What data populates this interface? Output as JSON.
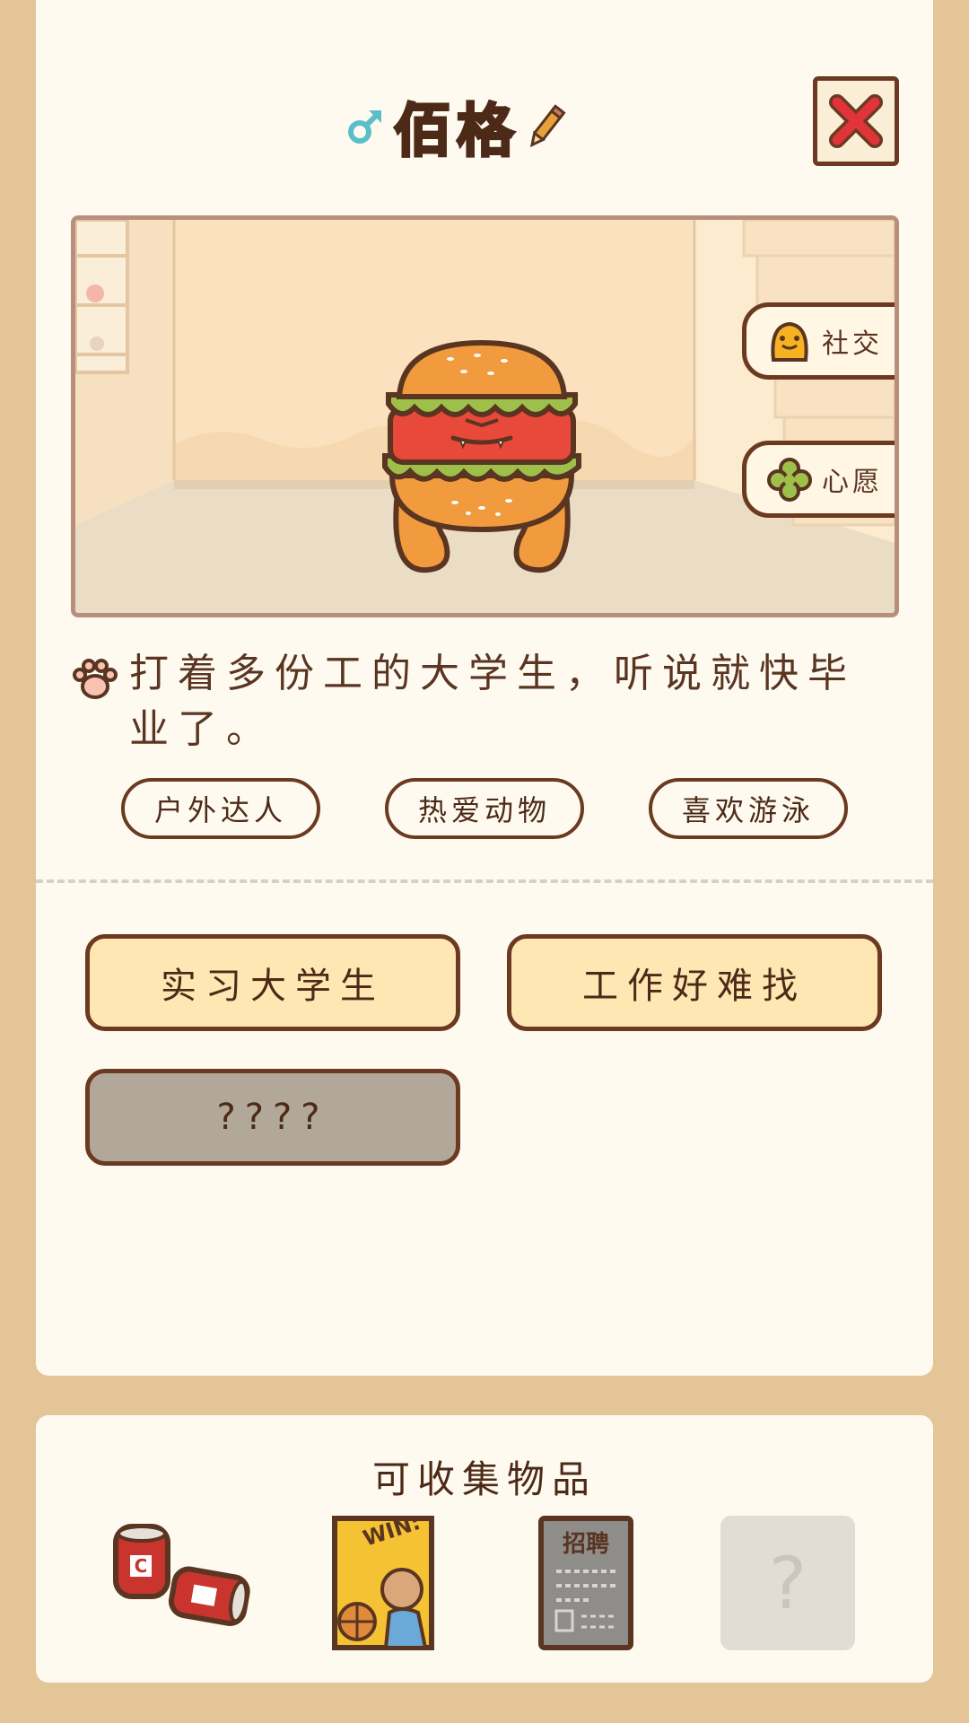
{
  "character": {
    "name": "佰格",
    "gender_icon": "male-symbol",
    "description": "打着多份工的大学生，听说就快毕业了。"
  },
  "colors": {
    "background": "#e3c597",
    "card": "#fffaf0",
    "accent_border": "#6b3a20",
    "trait_fill": "#ffe7b4",
    "locked_fill": "#b2a899",
    "close_red": "#e0343a",
    "male_blue": "#5bbfc8"
  },
  "side_buttons": [
    {
      "label": "社交",
      "icon": "social-face-icon"
    },
    {
      "label": "心愿",
      "icon": "wish-clover-icon"
    }
  ],
  "tags": [
    "户外达人",
    "热爱动物",
    "喜欢游泳"
  ],
  "traits": [
    "实习大学生",
    "工作好难找",
    "????"
  ],
  "collectibles": {
    "title": "可收集物品",
    "items": [
      {
        "icon": "soda-cans-icon"
      },
      {
        "icon": "basketball-poster-icon",
        "text": "WIN:"
      },
      {
        "icon": "job-ad-paper-icon",
        "text": "招聘"
      },
      {
        "icon": "locked-item-icon",
        "text": "?"
      }
    ]
  }
}
